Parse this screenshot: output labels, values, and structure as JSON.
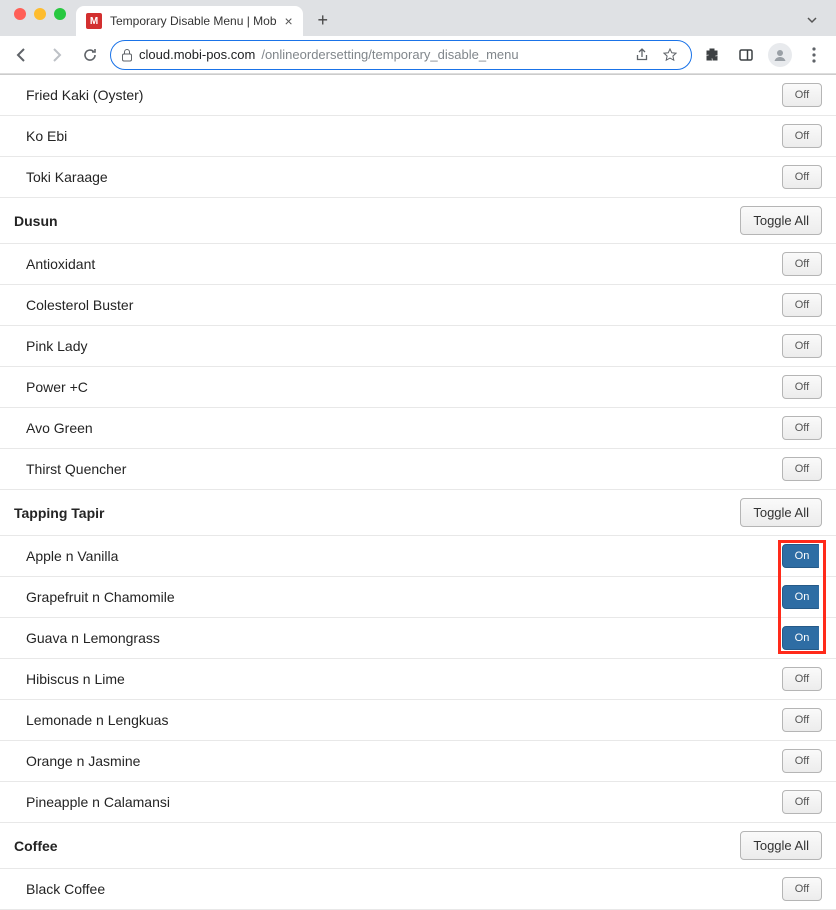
{
  "browser": {
    "tab_title": "Temporary Disable Menu | Mob",
    "favicon_letter": "M",
    "url_host": "cloud.mobi-pos.com",
    "url_path": "/onlineordersetting/temporary_disable_menu",
    "new_tab": "+",
    "close_tab": "×"
  },
  "labels": {
    "toggle_all": "Toggle All",
    "on": "On",
    "off": "Off"
  },
  "sections": [
    {
      "type": "item",
      "name": "Fried Kaki (Oyster)",
      "state": "off"
    },
    {
      "type": "item",
      "name": "Ko Ebi",
      "state": "off"
    },
    {
      "type": "item",
      "name": "Toki Karaage",
      "state": "off"
    },
    {
      "type": "category",
      "name": "Dusun"
    },
    {
      "type": "item",
      "name": "Antioxidant",
      "state": "off"
    },
    {
      "type": "item",
      "name": "Colesterol Buster",
      "state": "off"
    },
    {
      "type": "item",
      "name": "Pink Lady",
      "state": "off"
    },
    {
      "type": "item",
      "name": "Power +C",
      "state": "off"
    },
    {
      "type": "item",
      "name": "Avo Green",
      "state": "off"
    },
    {
      "type": "item",
      "name": "Thirst Quencher",
      "state": "off"
    },
    {
      "type": "category",
      "name": "Tapping Tapir"
    },
    {
      "type": "item",
      "name": "Apple n Vanilla",
      "state": "on"
    },
    {
      "type": "item",
      "name": "Grapefruit n Chamomile",
      "state": "on"
    },
    {
      "type": "item",
      "name": "Guava n Lemongrass",
      "state": "on"
    },
    {
      "type": "item",
      "name": "Hibiscus n Lime",
      "state": "off"
    },
    {
      "type": "item",
      "name": "Lemonade n Lengkuas",
      "state": "off"
    },
    {
      "type": "item",
      "name": "Orange n Jasmine",
      "state": "off"
    },
    {
      "type": "item",
      "name": "Pineapple n Calamansi",
      "state": "off"
    },
    {
      "type": "category",
      "name": "Coffee"
    },
    {
      "type": "item",
      "name": "Black Coffee",
      "state": "off"
    }
  ],
  "highlight": {
    "description": "red rectangle around On toggles for Apple n Vanilla, Grapefruit n Chamomile, Guava n Lemongrass"
  }
}
